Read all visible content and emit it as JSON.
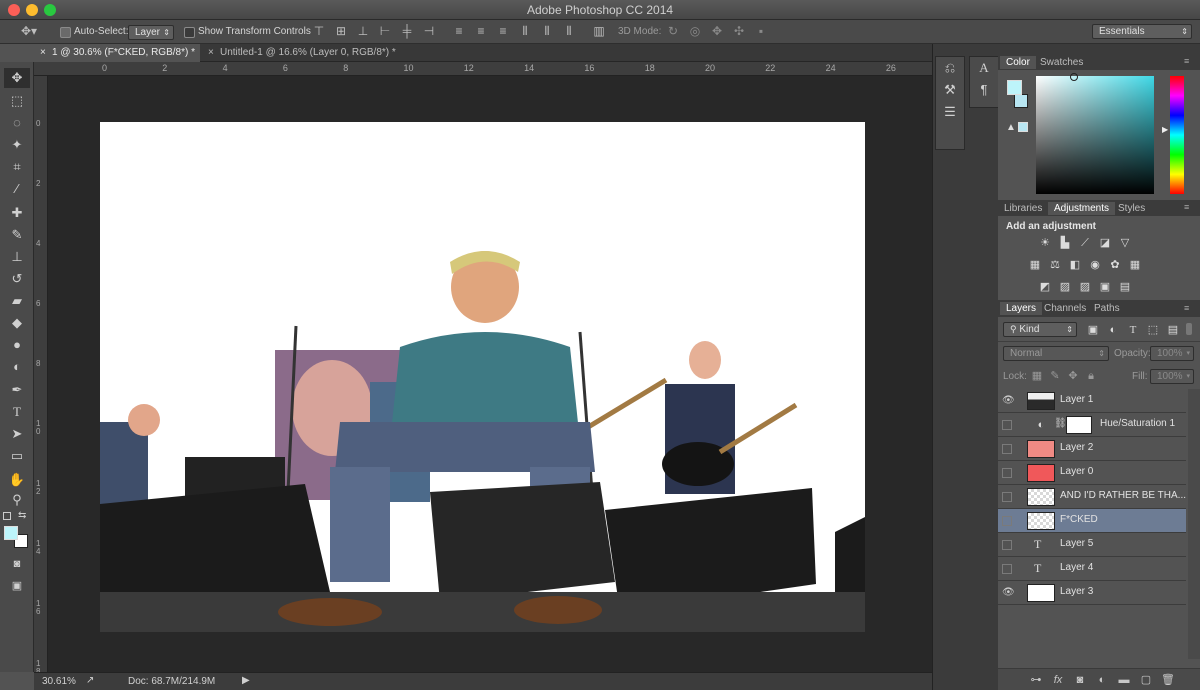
{
  "app": {
    "title": "Adobe Photoshop CC 2014"
  },
  "options_bar": {
    "auto_select_label": "Auto-Select:",
    "auto_select_value": "Layer",
    "show_transform_label": "Show Transform Controls",
    "mode_3d_label": "3D Mode:",
    "workspace": "Essentials"
  },
  "tabs": [
    {
      "label": "1 @ 30.6% (F*CKED, RGB/8*) *",
      "close": "×",
      "active": true
    },
    {
      "label": "Untitled-1 @ 16.6% (Layer 0, RGB/8*) *",
      "close": "×",
      "active": false
    }
  ],
  "ruler": {
    "top_ticks": [
      "0",
      "2",
      "4",
      "6",
      "8",
      "10",
      "12",
      "14",
      "16",
      "18",
      "20",
      "22",
      "24",
      "26"
    ],
    "left_ticks": [
      "0",
      "2",
      "4",
      "6",
      "8",
      "1\n0",
      "1\n2",
      "1\n4",
      "1\n6",
      "1\n8"
    ]
  },
  "status": {
    "zoom": "30.61%",
    "doc": "Doc: 68.7M/214.9M"
  },
  "color_panel": {
    "tabs": [
      "Color",
      "Swatches"
    ],
    "foreground": "#bdf4fa",
    "background": "#b8e6f2",
    "field_hue": "#3fd8e6"
  },
  "adjustments_panel": {
    "tabs": [
      "Libraries",
      "Adjustments",
      "Styles"
    ],
    "heading": "Add an adjustment"
  },
  "layers_panel": {
    "tabs": [
      "Layers",
      "Channels",
      "Paths"
    ],
    "filter_kind": "Kind",
    "blend_mode": "Normal",
    "opacity_label": "Opacity:",
    "opacity_value": "100%",
    "lock_label": "Lock:",
    "fill_label": "Fill:",
    "fill_value": "100%",
    "layers": [
      {
        "name": "Layer 1",
        "visible": true,
        "thumb": "photo",
        "selected": false
      },
      {
        "name": "Hue/Saturation 1",
        "visible": false,
        "thumb": "adjustment",
        "selected": false
      },
      {
        "name": "Layer 2",
        "visible": false,
        "thumb": "#f08a84",
        "selected": false
      },
      {
        "name": "Layer 0",
        "visible": false,
        "thumb": "#f0585a",
        "selected": false
      },
      {
        "name": "AND I'D RATHER BE    THA...",
        "visible": false,
        "thumb": "checker",
        "selected": false
      },
      {
        "name": "F*CKED",
        "visible": false,
        "thumb": "checker",
        "selected": true
      },
      {
        "name": "Layer 5",
        "visible": false,
        "thumb": "text",
        "selected": false
      },
      {
        "name": "Layer 4",
        "visible": false,
        "thumb": "text",
        "selected": false
      },
      {
        "name": "Layer 3",
        "visible": true,
        "thumb": "#ffffff",
        "selected": false
      }
    ]
  },
  "icons": {
    "move": "✥",
    "marquee": "⬚",
    "lasso": "◌",
    "wand": "✦",
    "crop": "⌗",
    "eyedropper": "⁄",
    "healing": "✚",
    "brush": "✎",
    "stamp": "⊥",
    "history": "↺",
    "eraser": "▰",
    "bucket": "◆",
    "blur": "●",
    "dodge": "◐",
    "pen": "✒",
    "type": "T",
    "path-select": "➤",
    "shape": "▭",
    "hand": "✋",
    "zoom": "⚲"
  }
}
